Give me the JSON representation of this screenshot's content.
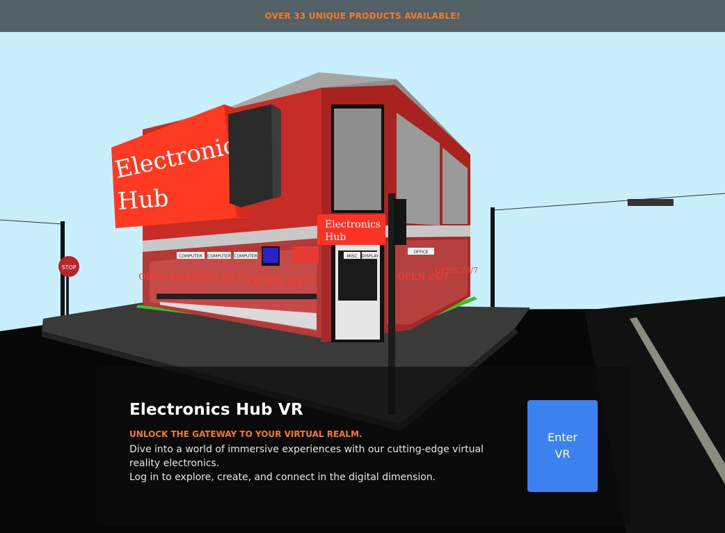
{
  "banner": {
    "text": "OVER 33 UNIQUE PRODUCTS AVAILABLE!"
  },
  "scene": {
    "store_sign": "Electronics Hub",
    "store_sign_lines": [
      "Electronics",
      "Hub"
    ],
    "hanging_sign_lines": [
      "Electronics",
      "Hub"
    ],
    "window_text": "OPEN 24/7",
    "stop_sign": "STOP",
    "shelf_labels": [
      "COMPUTER",
      "COMPUTER",
      "COMPUTER",
      "MISC",
      "DISPLAY",
      "OFFICE"
    ]
  },
  "hero": {
    "title": "Electronics Hub VR",
    "tagline": "UNLOCK THE GATEWAY TO YOUR VIRTUAL REALM.",
    "description": "Dive into a world of immersive experiences with our cutting-edge virtual reality electronics.",
    "description2": "Log in to explore, create, and connect in the digital dimension.",
    "enter_button": "Enter VR"
  },
  "colors": {
    "accent_orange": "#f37b24",
    "button_blue": "#3b82f0",
    "banner_bg": "#536166",
    "sky": "#c9eefc",
    "store_red": "#d8292a"
  }
}
